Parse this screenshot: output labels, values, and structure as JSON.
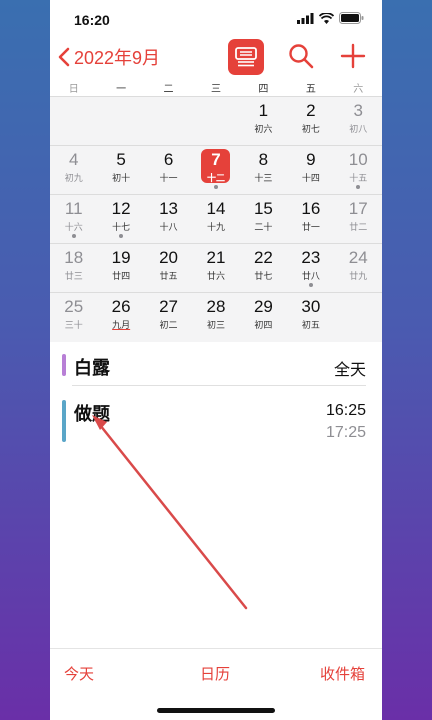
{
  "status": {
    "time": "16:20"
  },
  "header": {
    "back_label": "2022年9月"
  },
  "weekdays": [
    "日",
    "一",
    "二",
    "三",
    "四",
    "五",
    "六"
  ],
  "weeks": [
    [
      null,
      null,
      null,
      null,
      {
        "d": "1",
        "l": "初六"
      },
      {
        "d": "2",
        "l": "初七"
      },
      {
        "d": "3",
        "l": "初八"
      }
    ],
    [
      {
        "d": "4",
        "l": "初九"
      },
      {
        "d": "5",
        "l": "初十"
      },
      {
        "d": "6",
        "l": "十一"
      },
      {
        "d": "7",
        "l": "十二"
      },
      {
        "d": "8",
        "l": "十三"
      },
      {
        "d": "9",
        "l": "十四"
      },
      {
        "d": "10",
        "l": "十五"
      }
    ],
    [
      {
        "d": "11",
        "l": "十六"
      },
      {
        "d": "12",
        "l": "十七"
      },
      {
        "d": "13",
        "l": "十八"
      },
      {
        "d": "14",
        "l": "十九"
      },
      {
        "d": "15",
        "l": "二十"
      },
      {
        "d": "16",
        "l": "廿一"
      },
      {
        "d": "17",
        "l": "廿二"
      }
    ],
    [
      {
        "d": "18",
        "l": "廿三"
      },
      {
        "d": "19",
        "l": "廿四"
      },
      {
        "d": "20",
        "l": "廿五"
      },
      {
        "d": "21",
        "l": "廿六"
      },
      {
        "d": "22",
        "l": "廿七"
      },
      {
        "d": "23",
        "l": "廿八"
      },
      {
        "d": "24",
        "l": "廿九"
      }
    ],
    [
      {
        "d": "25",
        "l": "三十"
      },
      {
        "d": "26",
        "l": "九月"
      },
      {
        "d": "27",
        "l": "初二"
      },
      {
        "d": "28",
        "l": "初三"
      },
      {
        "d": "29",
        "l": "初四"
      },
      {
        "d": "30",
        "l": "初五"
      },
      null
    ]
  ],
  "today": "7",
  "event_dot_days": [
    "7",
    "10",
    "11",
    "12",
    "23"
  ],
  "lunar_month_start_day": "26",
  "events": {
    "solar_term": {
      "title": "白露",
      "time": "全天",
      "color": "#b87fd6"
    },
    "task": {
      "title": "做题",
      "start": "16:25",
      "end": "17:25",
      "color": "#5aa6c8"
    }
  },
  "tabs": {
    "today": "今天",
    "calendars": "日历",
    "inbox": "收件箱"
  },
  "colors": {
    "accent": "#e5413a",
    "annotation_arrow": "#d94a4a"
  }
}
